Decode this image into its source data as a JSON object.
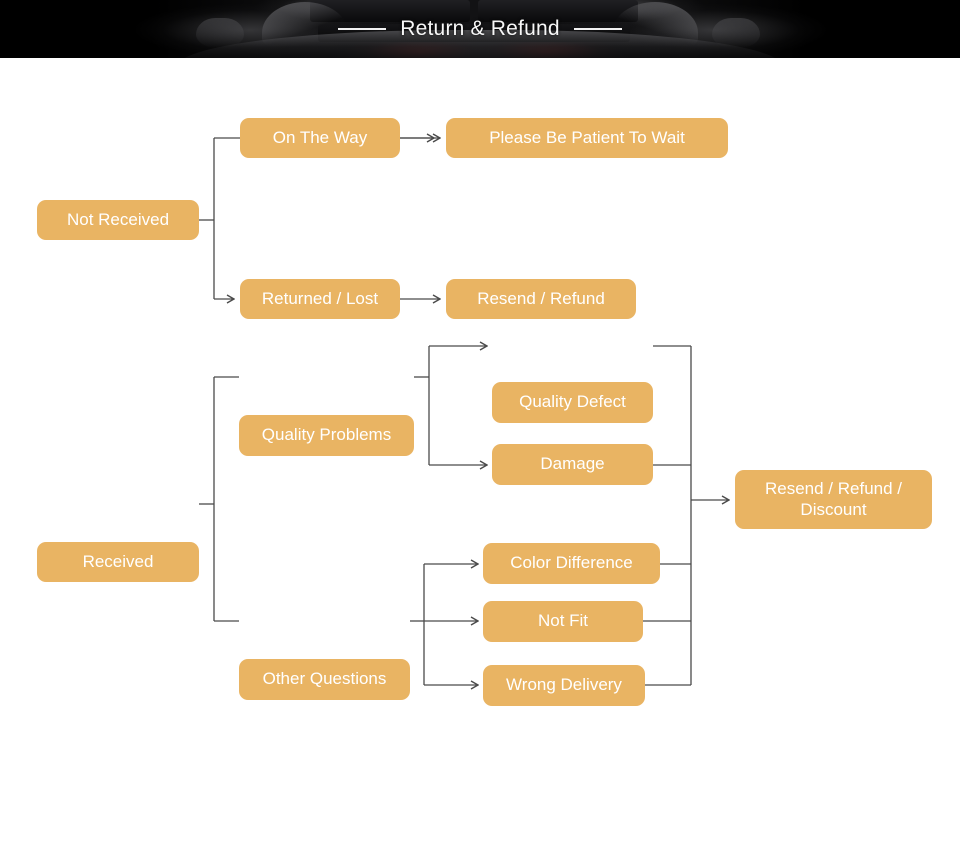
{
  "banner": {
    "title": "Return & Refund",
    "background_color": "#000000",
    "title_color": "#f7f7f7",
    "rule_left": "",
    "rule_right": ""
  },
  "theme": {
    "node_fill": "#e9b463",
    "node_text": "#ffffff",
    "connector": "#4a4a4a",
    "page_background": "#ffffff"
  },
  "flow": {
    "nodes": {
      "not_received": "Not Received",
      "on_the_way": "On The Way",
      "please_wait": "Please Be Patient To Wait",
      "returned_lost": "Returned / Lost",
      "resend_refund": "Resend / Refund",
      "received": "Received",
      "quality_problems": "Quality Problems",
      "quality_defect": "Quality Defect",
      "damage": "Damage",
      "other_questions": "Other Questions",
      "color_difference": "Color Difference",
      "not_fit": "Not Fit",
      "wrong_delivery": "Wrong Delivery",
      "resend_refund_discount": "Resend / Refund /\nDiscount"
    }
  }
}
